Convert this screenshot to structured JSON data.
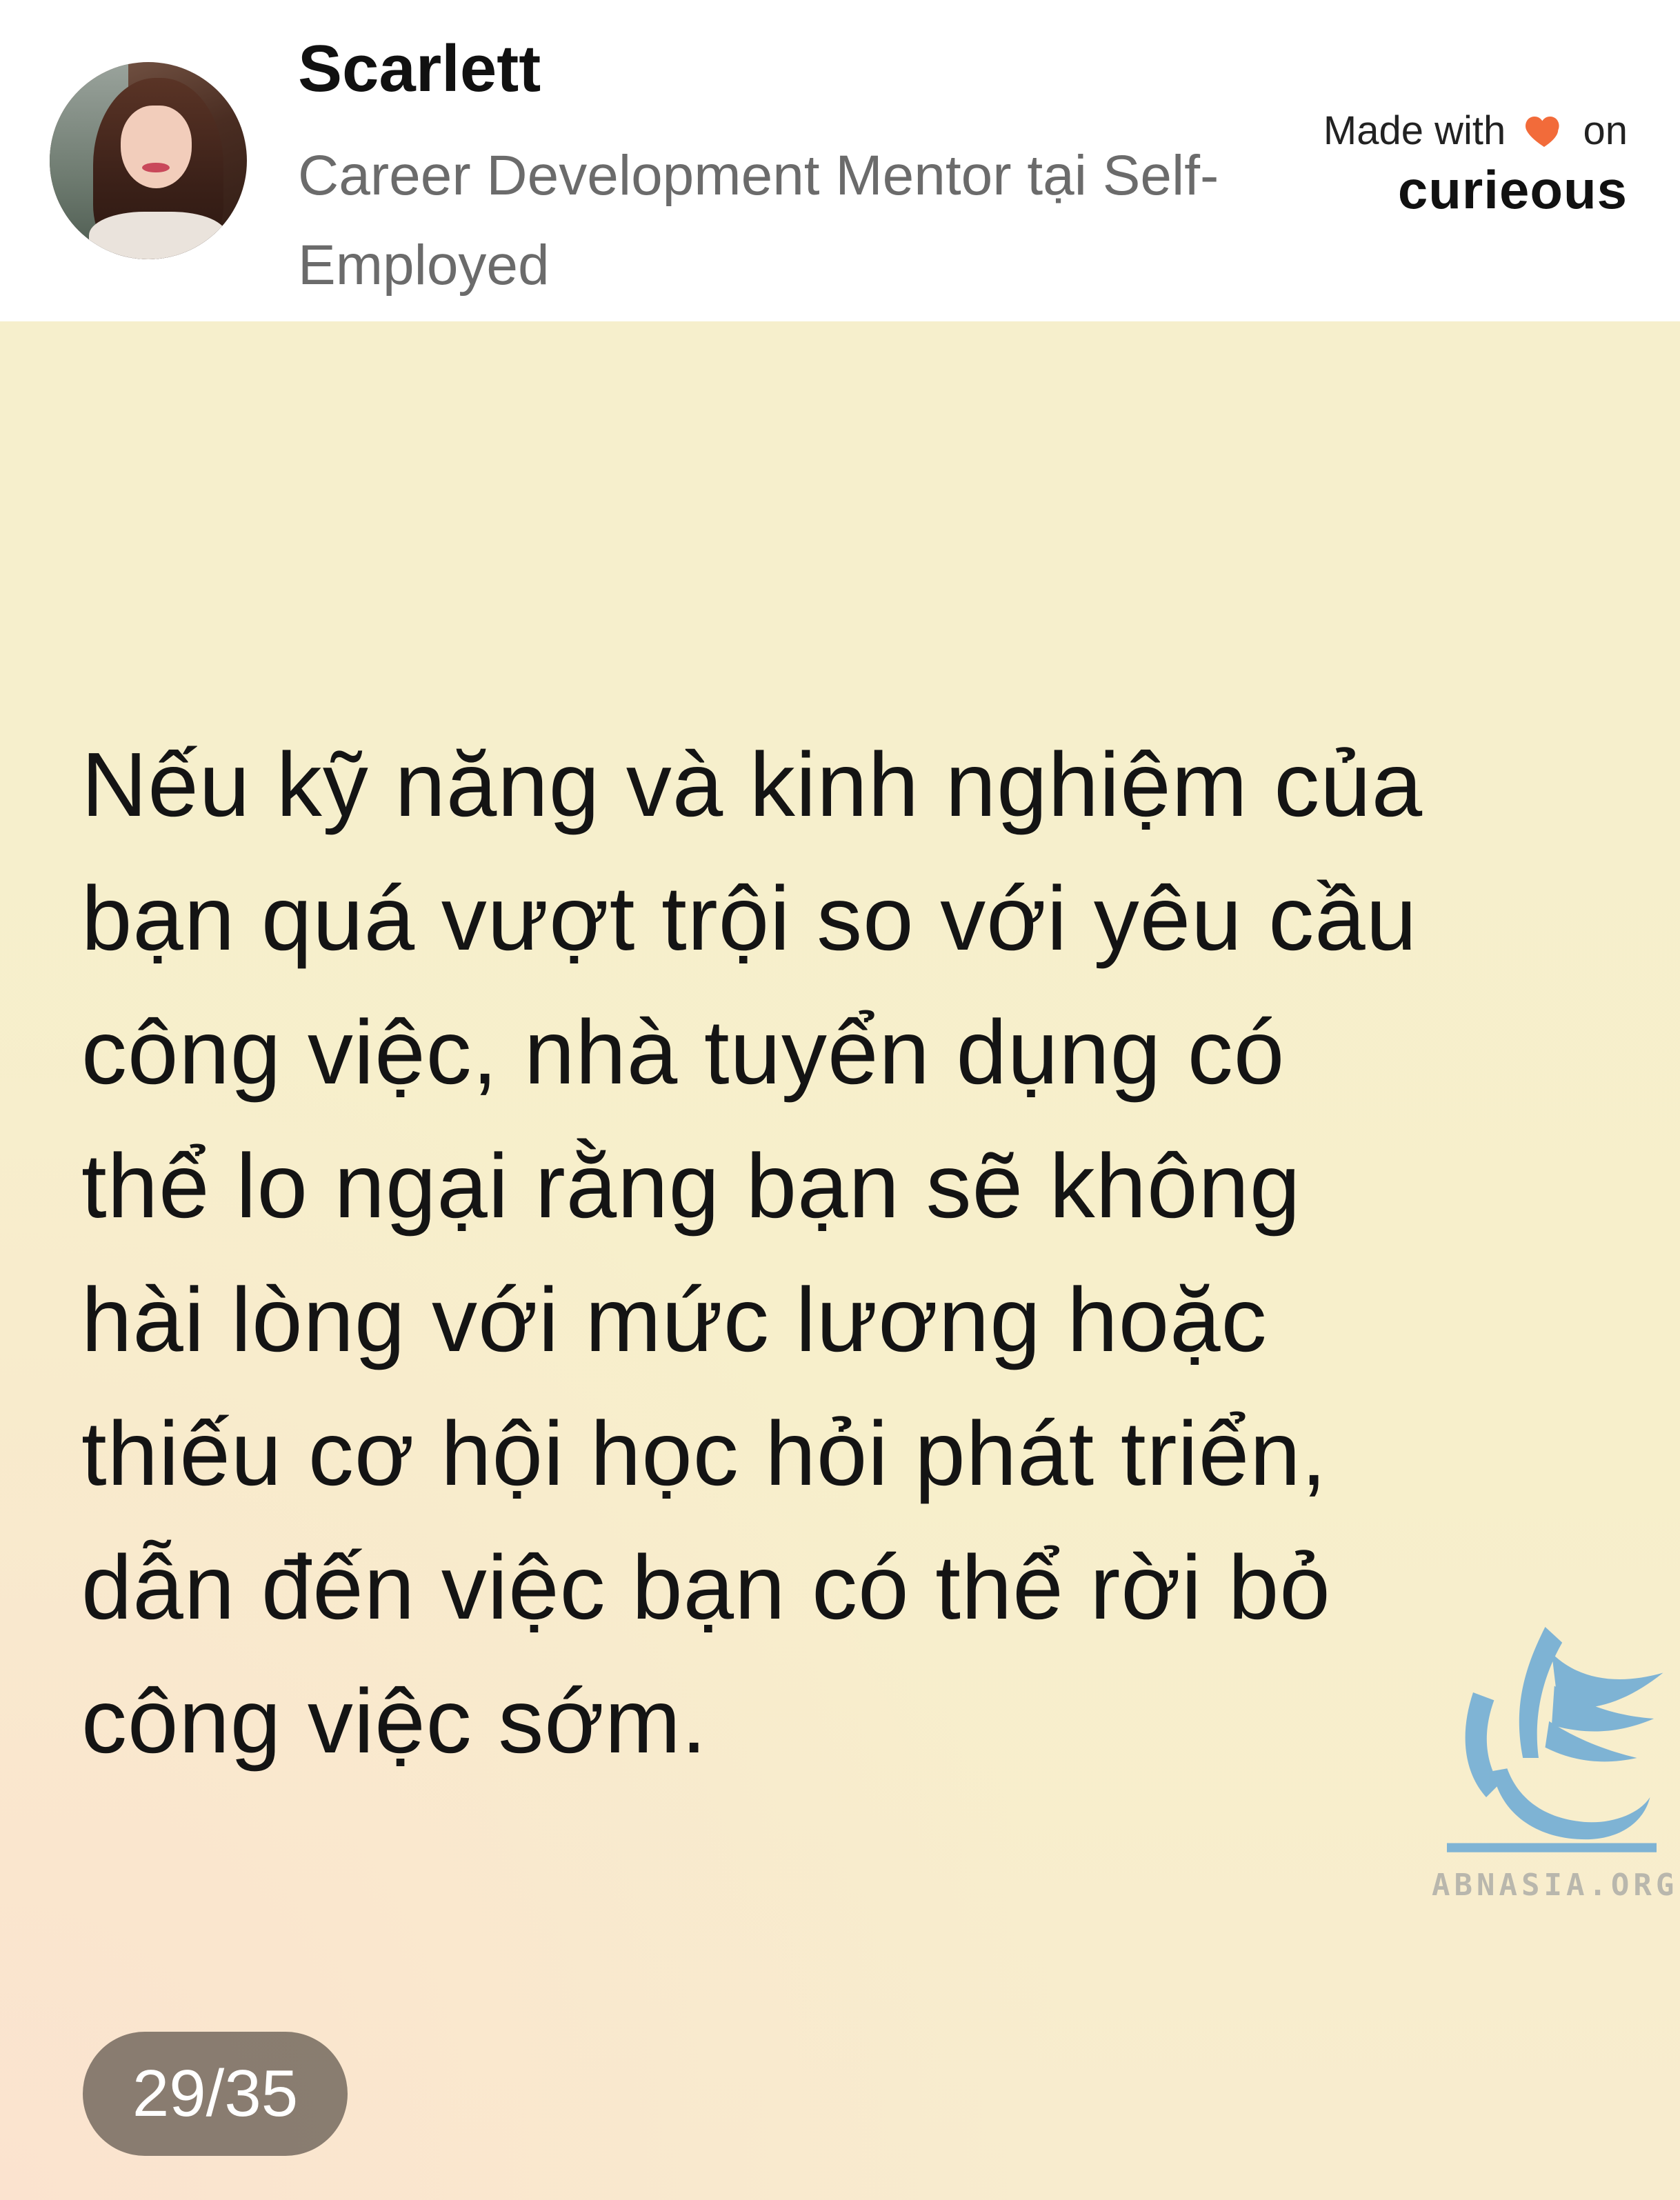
{
  "profile": {
    "name": "Scarlett",
    "headline": "Career Development Mentor tại Self-Employed"
  },
  "brand": {
    "made_with": "Made with",
    "on": "on",
    "logo": "curieous",
    "heart_color": "#f26b3a"
  },
  "card": {
    "quote_lines": [
      "Nếu kỹ năng và kinh nghiệm của",
      "bạn quá vượt trội so với yêu cầu",
      "công việc, nhà tuyển dụng có",
      "thể lo ngại rằng bạn sẽ không",
      "hài lòng với mức lương hoặc",
      "thiếu cơ hội học hỏi phát triển,",
      "dẫn đến việc bạn có thể rời bỏ",
      "công việc sớm."
    ],
    "page_counter": "29/35",
    "background_color": "#f6efcc"
  },
  "watermark": {
    "text": "ABNASIA.ORG",
    "icon": "griffin-logo-icon",
    "color": "#6aa9d6"
  }
}
